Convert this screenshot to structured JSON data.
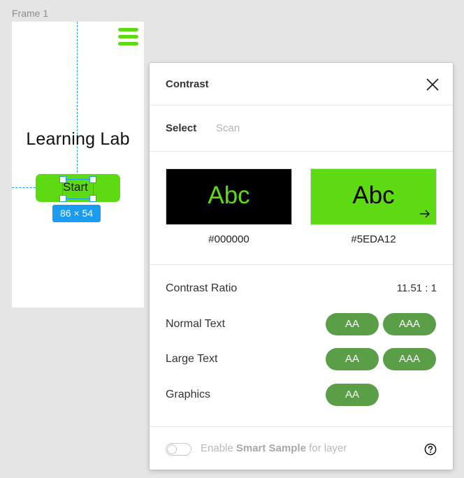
{
  "canvas": {
    "frame_label": "Frame 1",
    "app_title": "Learning Lab",
    "start_button": "Start",
    "dimension_badge": "86 × 54",
    "accent": "#5EDA12",
    "selection_color": "#1A9CF0"
  },
  "panel": {
    "title": "Contrast",
    "tabs": [
      {
        "label": "Select",
        "active": true
      },
      {
        "label": "Scan",
        "active": false
      }
    ],
    "swatches": [
      {
        "sample": "Abc",
        "hex": "#000000",
        "background": "#000000",
        "text_color": "#5EDA12"
      },
      {
        "sample": "Abc",
        "hex": "#5EDA12",
        "background": "#5EDA12",
        "text_color": "#000000"
      }
    ],
    "contrast_ratio": {
      "label": "Contrast Ratio",
      "value": "11.51 : 1"
    },
    "checks": [
      {
        "label": "Normal Text",
        "badges": [
          "AA",
          "AAA"
        ]
      },
      {
        "label": "Large Text",
        "badges": [
          "AA",
          "AAA"
        ]
      },
      {
        "label": "Graphics",
        "badges": [
          "AA"
        ]
      }
    ],
    "badge_color": "#5A9E48",
    "footer": {
      "toggle_on": false,
      "text_before": "Enable ",
      "text_bold": "Smart Sample",
      "text_after": " for layer"
    },
    "icons": {
      "close": "close-icon",
      "swap": "arrow-right-icon",
      "help": "help-icon",
      "menu": "hamburger-icon"
    }
  }
}
